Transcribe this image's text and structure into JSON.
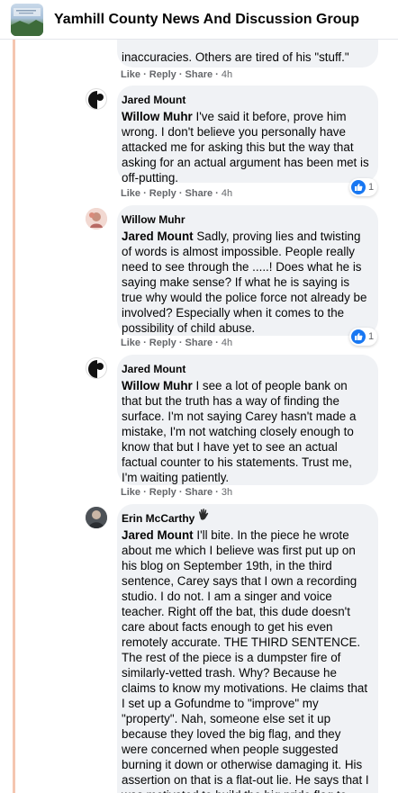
{
  "header": {
    "title": "Yamhill County News And Discussion Group"
  },
  "comments": [
    {
      "author": "",
      "tail_lines": [
        "inaccuracies. Others are tired of his \"stuff.\""
      ],
      "actions": {
        "like": "Like",
        "reply": "Reply",
        "share": "Share",
        "time": "4h"
      }
    },
    {
      "author": "Jared Mount",
      "mention": "Willow Muhr",
      "body": "I've said it before, prove him wrong. I don't believe you personally have attacked me for asking this but the way that asking for an actual argument has been met is off-putting.",
      "actions": {
        "like": "Like",
        "reply": "Reply",
        "share": "Share",
        "time": "4h"
      },
      "reaction_count": "1"
    },
    {
      "author": "Willow Muhr",
      "mention": "Jared Mount",
      "body": "Sadly, proving lies and twisting of words is almost impossible. People really need to see through the .....! Does what he is saying make sense? If what he is saying is true why would the police force not already be involved? Especially when it comes to the possibility of child abuse.",
      "actions": {
        "like": "Like",
        "reply": "Reply",
        "share": "Share",
        "time": "4h"
      },
      "reaction_count": "1"
    },
    {
      "author": "Jared Mount",
      "mention": "Willow Muhr",
      "body": "I see a lot of people bank on that but the truth has a way of finding the surface. I'm not saying Carey hasn't made a mistake, I'm not watching closely enough to know that but I have yet to see an actual factual counter to his statements. Trust me, I'm waiting patiently.",
      "actions": {
        "like": "Like",
        "reply": "Reply",
        "share": "Share",
        "time": "3h"
      }
    },
    {
      "author": "Erin McCarthy",
      "mention": "Jared Mount",
      "badge_icon": "waving-hand-icon",
      "body": "I'll bite. In the piece he wrote about me which I believe was first put up on his blog on September 19th, in the third sentence, Carey says that I own a recording studio. I do not. I am a singer and voice teacher. Right off the bat, this dude doesn't care about facts enough to get his even remotely accurate. THE THIRD SENTENCE. The rest of the piece is a dumpster fire of similarly-vetted trash. Why? Because he claims to know my motivations. He claims that I set up a Gofundme to \"improve\" my \"property\". Nah, someone else set it up because they loved the big flag, and they were concerned when people suggested burning it down or otherwise damaging it. His assertion on that is a flat-out lie. He says that I was motivated to build the big pride flag to"
    }
  ],
  "colors": {
    "bubble": "#f0f2f5",
    "text": "#050505",
    "meta": "#65676b",
    "like_blue": "#1877f2",
    "thread_line": "#f5c6b0"
  }
}
